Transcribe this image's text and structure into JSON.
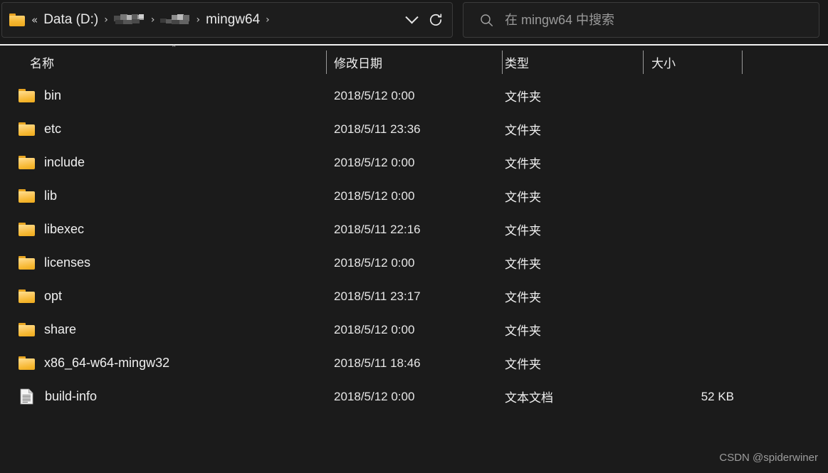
{
  "window": {
    "background": "#1b1b1b"
  },
  "address_bar": {
    "folder_icon": "folder-icon",
    "overflow_chevrons": "«",
    "separator": "›",
    "crumbs": [
      {
        "label": "Data (D:)",
        "redacted": false
      },
      {
        "label": "",
        "redacted": true
      },
      {
        "label": "",
        "redacted": true
      },
      {
        "label": "mingw64",
        "redacted": false
      }
    ],
    "dropdown_icon": "chevron-down-icon",
    "refresh_icon": "refresh-icon"
  },
  "search": {
    "icon": "search-icon",
    "placeholder": "在 mingw64 中搜索"
  },
  "columns": [
    {
      "key": "name",
      "label": "名称",
      "sorted": true,
      "sort_direction": "asc",
      "sort_caret": "˄"
    },
    {
      "key": "date",
      "label": "修改日期",
      "sorted": false
    },
    {
      "key": "type",
      "label": "类型",
      "sorted": false
    },
    {
      "key": "size",
      "label": "大小",
      "sorted": false
    }
  ],
  "files": [
    {
      "name": "bin",
      "date": "2018/5/12 0:00",
      "type": "文件夹",
      "size": "",
      "icon": "folder-icon"
    },
    {
      "name": "etc",
      "date": "2018/5/11 23:36",
      "type": "文件夹",
      "size": "",
      "icon": "folder-icon"
    },
    {
      "name": "include",
      "date": "2018/5/12 0:00",
      "type": "文件夹",
      "size": "",
      "icon": "folder-icon"
    },
    {
      "name": "lib",
      "date": "2018/5/12 0:00",
      "type": "文件夹",
      "size": "",
      "icon": "folder-icon"
    },
    {
      "name": "libexec",
      "date": "2018/5/11 22:16",
      "type": "文件夹",
      "size": "",
      "icon": "folder-icon"
    },
    {
      "name": "licenses",
      "date": "2018/5/12 0:00",
      "type": "文件夹",
      "size": "",
      "icon": "folder-icon"
    },
    {
      "name": "opt",
      "date": "2018/5/11 23:17",
      "type": "文件夹",
      "size": "",
      "icon": "folder-icon"
    },
    {
      "name": "share",
      "date": "2018/5/12 0:00",
      "type": "文件夹",
      "size": "",
      "icon": "folder-icon"
    },
    {
      "name": "x86_64-w64-mingw32",
      "date": "2018/5/11 18:46",
      "type": "文件夹",
      "size": "",
      "icon": "folder-icon"
    },
    {
      "name": "build-info",
      "date": "2018/5/12 0:00",
      "type": "文本文档",
      "size": "52 KB",
      "icon": "text-document-icon"
    }
  ],
  "watermark": {
    "text": "CSDN @spiderwiner"
  }
}
